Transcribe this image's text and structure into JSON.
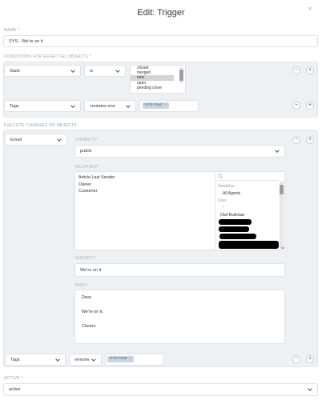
{
  "modal": {
    "title": "Edit: Trigger"
  },
  "name": {
    "label": "NAME *",
    "value": "SYS - We're on it"
  },
  "conditions": {
    "label": "CONDITIONS FOR EFFECTED OBJECTS *",
    "row1": {
      "attribute": "State",
      "operator": "is",
      "options": [
        "closed",
        "merged",
        "new",
        "open",
        "pending close"
      ],
      "selected_index": 2
    },
    "row2": {
      "attribute": "Tags",
      "operator": "contains one",
      "token": "SYS-Oast"
    }
  },
  "execute": {
    "label": "EXECUTE CHANGES ON OBJECTS",
    "action": "Email",
    "visibility": {
      "label": "VISIBILITY",
      "value": "public"
    },
    "recipient": {
      "label": "RECIPIENT",
      "selected": [
        "Article Last Sender",
        "Owner",
        "Customer"
      ],
      "search_placeholder": "",
      "groups": {
        "variables_label": "Variables",
        "variables": [
          "All Agents"
        ],
        "user_label": "User",
        "users": [
          "-",
          "Olaf Buitelaar"
        ]
      }
    },
    "subject": {
      "label": "SUBJECT",
      "value": "We're on it"
    },
    "body": {
      "label": "BODY",
      "lines": [
        "Dear,",
        "",
        "We're on it.",
        "",
        "Cheers"
      ]
    },
    "tags_row": {
      "attribute": "Tags",
      "operator": "remove",
      "token": "SYS-Oast"
    }
  },
  "active": {
    "label": "ACTIVE *",
    "value": "active"
  },
  "buttons": {
    "remove": "−",
    "add": "+",
    "close": "×",
    "token_remove": "×"
  },
  "icons": {
    "search": "search-icon",
    "close": "close-icon",
    "chevron": "chevron-down-icon"
  }
}
